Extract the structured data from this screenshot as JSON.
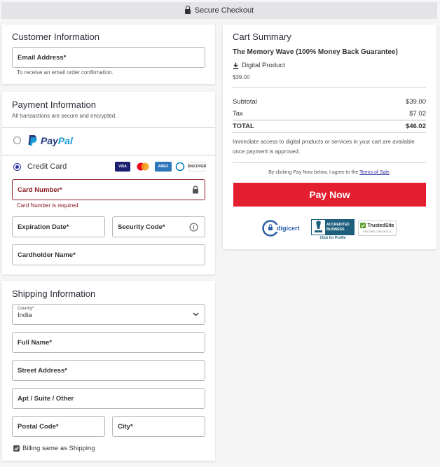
{
  "header": {
    "title": "Secure Checkout"
  },
  "customer": {
    "title": "Customer Information",
    "email_label": "Email Address*",
    "email_hint": "To receive an email order confirmation."
  },
  "payment": {
    "title": "Payment Information",
    "subtitle": "All transactions are secure and encrypted.",
    "paypal_pay": "Pay",
    "paypal_pal": "Pal",
    "credit_card_label": "Credit Card",
    "cards": [
      "VISA",
      "MC",
      "AMEX",
      "DINERS",
      "DISCOVER"
    ],
    "card_number_label": "Card Number*",
    "card_number_error": "Card Number is required",
    "expiration_label": "Expiration Date*",
    "security_label": "Security Code*",
    "cardholder_label": "Cardholder Name*"
  },
  "shipping": {
    "title": "Shipping Information",
    "country_label": "Country*",
    "country_value": "India",
    "full_name_label": "Full Name*",
    "street_label": "Street Address*",
    "apt_label": "Apt / Suite / Other",
    "postal_label": "Postal Code*",
    "city_label": "City*",
    "billing_same_label": "Billing same as Shipping"
  },
  "cart": {
    "title": "Cart Summary",
    "product_name": "The Memory Wave (100% Money Back Guarantee)",
    "product_type": "Digital Product",
    "product_price": "$39.00",
    "subtotal_label": "Subtotal",
    "subtotal_value": "$39.00",
    "tax_label": "Tax",
    "tax_value": "$7.02",
    "total_label": "TOTAL",
    "total_value": "$46.02",
    "access_note": "Immediate access to digital products or services in your cart are available once payment is approved.",
    "agree_prefix": "By clicking Pay Now below, I agree to the ",
    "terms_link": "Terms of Sale",
    "agree_suffix": ".",
    "pay_button": "Pay Now",
    "badges": {
      "digicert": "digicert",
      "bbb_line1": "ACCREDITED",
      "bbb_line2": "BUSINESS",
      "bbb_click": "Click for Profile",
      "trusted": "TrustedSite",
      "trusted_sub": "SECURE CHECKOUT"
    }
  },
  "colors": {
    "accent_red": "#e31e2f",
    "error": "#8a1c22",
    "radio_blue": "#2b2fa0"
  }
}
